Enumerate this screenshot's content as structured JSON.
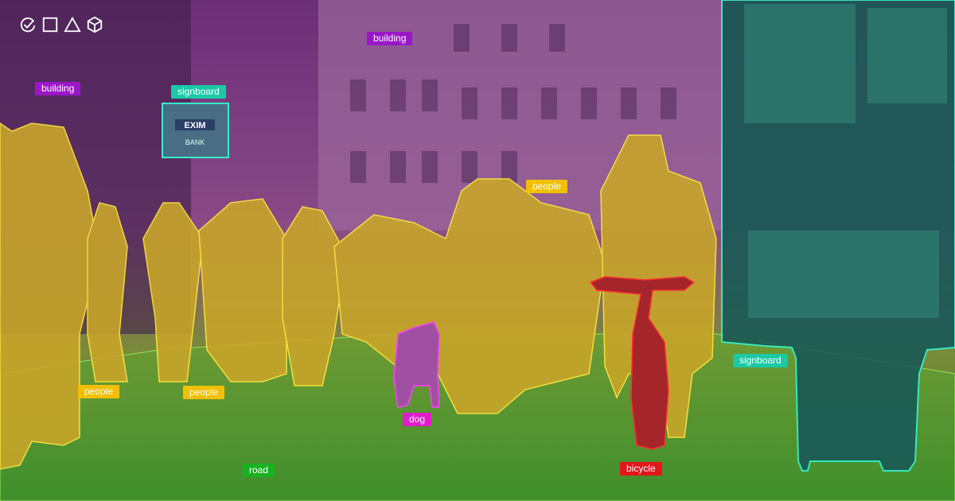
{
  "toolbar": {
    "icons": [
      "check-circle-icon",
      "square-icon",
      "triangle-icon",
      "cube-icon"
    ]
  },
  "colors": {
    "building": "#9a17c9",
    "signboard": "#1ac9a6",
    "people": "#f2bf00",
    "dog": "#e21ccc",
    "bicycle": "#e3161b",
    "road": "#17b21f"
  },
  "labels": {
    "building_left": "building",
    "building_top": "building",
    "signboard_left": "signboard",
    "signboard_right": "signboard",
    "people_center": "people",
    "people_left1": "people",
    "people_left2": "people",
    "dog": "dog",
    "bicycle": "bicycle",
    "road": "road"
  },
  "logos": {
    "bank_sign": "EXIM BANK"
  }
}
